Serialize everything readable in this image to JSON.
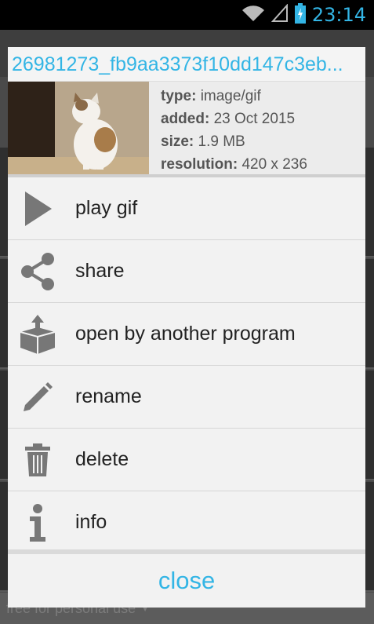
{
  "status_bar": {
    "time": "23:14",
    "icons": [
      "wifi-icon",
      "signal-icon",
      "battery-charging-icon"
    ]
  },
  "background": {
    "footer_text": "free for personal use"
  },
  "dialog": {
    "title": "26981273_fb9aa3373f10dd147c3eb...",
    "details": {
      "type_label": "type:",
      "type_value": "image/gif",
      "added_label": "added:",
      "added_value": "23 Oct 2015",
      "size_label": "size:",
      "size_value": "1.9 MB",
      "resolution_label": "resolution:",
      "resolution_value": "420 x 236"
    },
    "menu": [
      {
        "label": "play gif",
        "icon": "play-icon"
      },
      {
        "label": "share",
        "icon": "share-icon"
      },
      {
        "label": "open by another program",
        "icon": "open-box-icon"
      },
      {
        "label": "rename",
        "icon": "pencil-icon"
      },
      {
        "label": "delete",
        "icon": "trash-icon"
      },
      {
        "label": "info",
        "icon": "info-icon"
      }
    ],
    "close_label": "close"
  },
  "colors": {
    "accent": "#33b5e5",
    "dialog_bg": "#f2f2f2",
    "icon_gray": "#777777"
  }
}
